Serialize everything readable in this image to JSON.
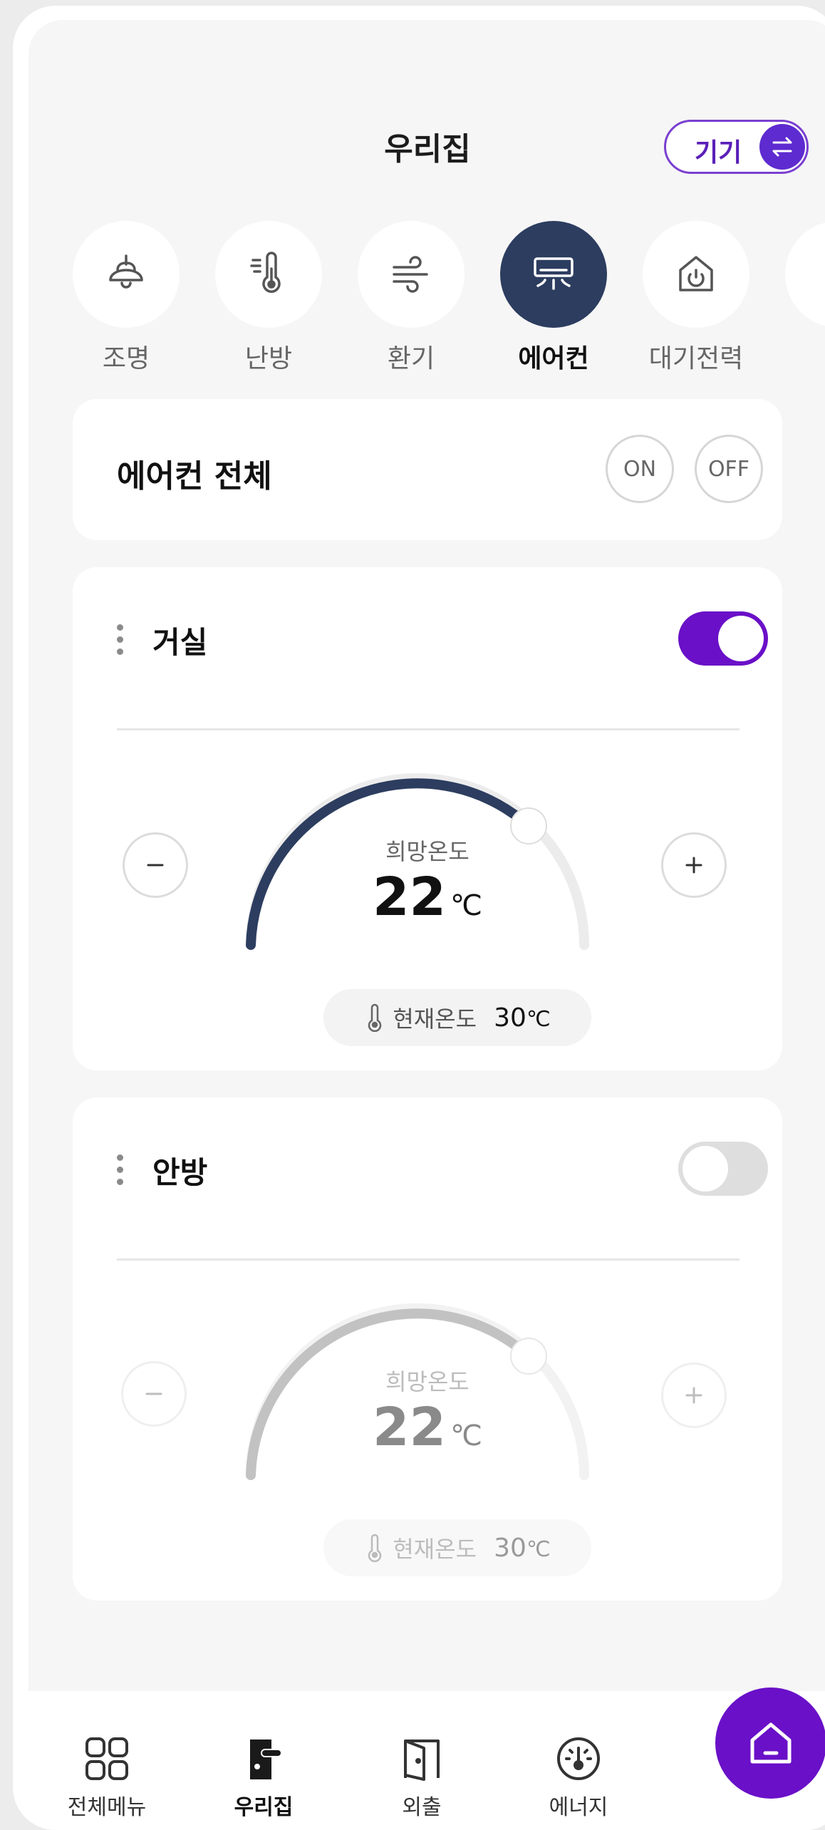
{
  "header": {
    "title": "우리집",
    "device_button": "기기"
  },
  "categories": [
    {
      "label": "조명",
      "icon": "lamp-icon"
    },
    {
      "label": "난방",
      "icon": "heating-thermometer-icon"
    },
    {
      "label": "환기",
      "icon": "wind-icon"
    },
    {
      "label": "에어컨",
      "icon": "air-conditioner-icon",
      "active": true
    },
    {
      "label": "대기전력",
      "icon": "standby-power-icon"
    }
  ],
  "all_control": {
    "title": "에어컨 전체",
    "on_label": "ON",
    "off_label": "OFF"
  },
  "rooms": [
    {
      "name": "거실",
      "power_on": true,
      "target_label": "희망온도",
      "target_temp": "22",
      "unit": "℃",
      "current_label": "현재온도",
      "current_temp": "30",
      "dial_level": 0.72
    },
    {
      "name": "안방",
      "power_on": false,
      "target_label": "희망온도",
      "target_temp": "22",
      "unit": "℃",
      "current_label": "현재온도",
      "current_temp": "30",
      "dial_level": 0.72
    }
  ],
  "nav": {
    "items": [
      {
        "label": "전체메뉴",
        "icon": "grid-menu-icon"
      },
      {
        "label": "우리집",
        "icon": "home-door-icon",
        "active": true
      },
      {
        "label": "외출",
        "icon": "door-exit-icon"
      },
      {
        "label": "에너지",
        "icon": "energy-gauge-icon"
      }
    ],
    "fab_icon": "home-icon"
  },
  "colors": {
    "accent": "#6a10c8",
    "active_category": "#2c3d5f",
    "gauge_active": "#2c3d5f"
  }
}
